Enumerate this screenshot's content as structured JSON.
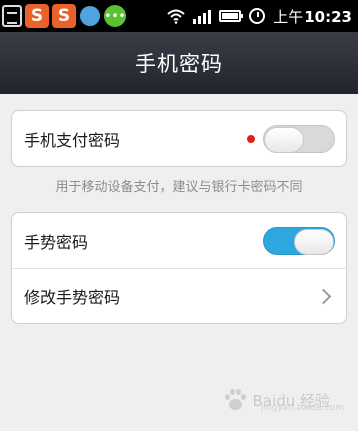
{
  "status_bar": {
    "app_icons": [
      "clipboard-icon",
      "sogou-s-icon",
      "sogou-s-icon",
      "qq-icon",
      "wechat-icon"
    ],
    "sogou_letter": "S",
    "time_prefix": "上午",
    "time": "10:23"
  },
  "header": {
    "title": "手机密码"
  },
  "payment_card": {
    "label": "手机支付密码",
    "switch_state": "off",
    "red_dot": true
  },
  "hint": "用于移动设备支付，建议与银行卡密码不同",
  "gesture_card": {
    "toggle_row": {
      "label": "手势密码",
      "switch_state": "on"
    },
    "modify_row": {
      "label": "修改手势密码"
    }
  },
  "watermark": {
    "text": "Baidu 经验",
    "subtext": "jingyan.baidu.com"
  },
  "colors": {
    "switch_on": "#2ea7e0",
    "header_bg": "#2c2e36",
    "red_dot": "#e0201b"
  }
}
